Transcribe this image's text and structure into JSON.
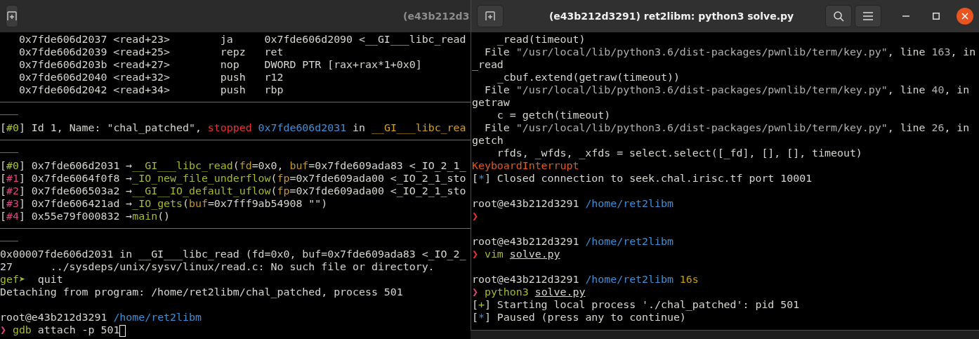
{
  "windows": [
    {
      "title": "(e43b212d3",
      "active": false,
      "lines": [
        {
          "kind": "text",
          "segments": [
            {
              "kind": "plain",
              "text": "   0x7fde606d2037 <read+23>        ja     0x7fde606d2090 <__GI___libc_read"
            }
          ]
        },
        {
          "kind": "text",
          "segments": [
            {
              "kind": "plain",
              "text": "   0x7fde606d2039 <read+25>        repz   ret"
            }
          ]
        },
        {
          "kind": "text",
          "segments": [
            {
              "kind": "plain",
              "text": "   0x7fde606d203b <read+27>        nop    DWORD PTR [rax+rax*1+0x0]"
            }
          ]
        },
        {
          "kind": "text",
          "segments": [
            {
              "kind": "plain",
              "text": "   0x7fde606d2040 <read+32>        push   r12"
            }
          ]
        },
        {
          "kind": "text",
          "segments": [
            {
              "kind": "plain",
              "text": "   0x7fde606d2042 <read+34>        push   rbp"
            }
          ]
        },
        {
          "kind": "rule"
        },
        {
          "kind": "dash"
        },
        {
          "kind": "text",
          "segments": [
            {
              "kind": "plain",
              "text": "["
            },
            {
              "kind": "green",
              "text": "#0"
            },
            {
              "kind": "plain",
              "text": "] Id 1, Name: \"chal_patched\", "
            },
            {
              "kind": "red",
              "text": "stopped "
            },
            {
              "kind": "blue",
              "text": "0x7fde606d2031"
            },
            {
              "kind": "plain",
              "text": " in "
            },
            {
              "kind": "yellow",
              "text": "__GI___libc_rea"
            }
          ]
        },
        {
          "kind": "rule"
        },
        {
          "kind": "dash"
        },
        {
          "kind": "text",
          "segments": [
            {
              "kind": "plain",
              "text": "["
            },
            {
              "kind": "green",
              "text": "#0"
            },
            {
              "kind": "plain",
              "text": "] 0x7fde606d2031 →"
            },
            {
              "kind": "olive",
              "text": "__GI___libc_read"
            },
            {
              "kind": "plain",
              "text": "("
            },
            {
              "kind": "param",
              "text": "fd"
            },
            {
              "kind": "plain",
              "text": "=0x0, "
            },
            {
              "kind": "param",
              "text": "buf"
            },
            {
              "kind": "plain",
              "text": "=0x7fde609ada83 <_IO_2_1_"
            }
          ]
        },
        {
          "kind": "text",
          "segments": [
            {
              "kind": "plain",
              "text": "["
            },
            {
              "kind": "pink",
              "text": "#1"
            },
            {
              "kind": "plain",
              "text": "] 0x7fde6064f0f8 →"
            },
            {
              "kind": "olive",
              "text": "_IO_new_file_underflow"
            },
            {
              "kind": "plain",
              "text": "("
            },
            {
              "kind": "param",
              "text": "fp"
            },
            {
              "kind": "plain",
              "text": "=0x7fde609ada00 <_IO_2_1_sto"
            }
          ]
        },
        {
          "kind": "text",
          "segments": [
            {
              "kind": "plain",
              "text": "["
            },
            {
              "kind": "pink",
              "text": "#2"
            },
            {
              "kind": "plain",
              "text": "] 0x7fde606503a2 →"
            },
            {
              "kind": "olive",
              "text": "__GI__IO_default_uflow"
            },
            {
              "kind": "plain",
              "text": "("
            },
            {
              "kind": "param",
              "text": "fp"
            },
            {
              "kind": "plain",
              "text": "=0x7fde609ada00 <_IO_2_1_sto"
            }
          ]
        },
        {
          "kind": "text",
          "segments": [
            {
              "kind": "plain",
              "text": "["
            },
            {
              "kind": "pink",
              "text": "#3"
            },
            {
              "kind": "plain",
              "text": "] 0x7fde606421ad →"
            },
            {
              "kind": "olive",
              "text": "_IO_gets"
            },
            {
              "kind": "plain",
              "text": "("
            },
            {
              "kind": "param",
              "text": "buf"
            },
            {
              "kind": "plain",
              "text": "=0x7fff9ab54908 \"\")"
            }
          ]
        },
        {
          "kind": "text",
          "segments": [
            {
              "kind": "plain",
              "text": "["
            },
            {
              "kind": "pink",
              "text": "#4"
            },
            {
              "kind": "plain",
              "text": "] 0x55e79f000832 →"
            },
            {
              "kind": "olive",
              "text": "main"
            },
            {
              "kind": "plain",
              "text": "()"
            }
          ]
        },
        {
          "kind": "rule"
        },
        {
          "kind": "dash"
        },
        {
          "kind": "text",
          "segments": [
            {
              "kind": "plain",
              "text": "0x00007fde606d2031 in __GI___libc_read (fd=0x0, buf=0x7fde609ada83 <_IO_2_"
            }
          ]
        },
        {
          "kind": "text",
          "segments": [
            {
              "kind": "plain",
              "text": "27      ../sysdeps/unix/sysv/linux/read.c: No such file or directory."
            }
          ]
        },
        {
          "kind": "text",
          "segments": [
            {
              "kind": "olive",
              "text": "gef➤"
            },
            {
              "kind": "plain",
              "text": "  quit"
            }
          ]
        },
        {
          "kind": "text",
          "segments": [
            {
              "kind": "plain",
              "text": "Detaching from program: /home/ret2libm/chal_patched, process 501"
            }
          ]
        },
        {
          "kind": "blank"
        },
        {
          "kind": "text",
          "segments": [
            {
              "kind": "plain",
              "text": "root@e43b212d3291 "
            },
            {
              "kind": "blue",
              "text": "/home/ret2libm"
            }
          ]
        },
        {
          "kind": "text",
          "segments": [
            {
              "kind": "pink",
              "text": "❯ "
            },
            {
              "kind": "olive",
              "text": "gdb"
            },
            {
              "kind": "plain",
              "text": " attach -p 501"
            },
            {
              "kind": "cursor"
            }
          ]
        }
      ]
    },
    {
      "title": "(e43b212d3291) ret2libm: python3 solve.py",
      "active": true,
      "lines": [
        {
          "kind": "text",
          "segments": [
            {
              "kind": "plain",
              "text": "    _read(timeout)"
            }
          ]
        },
        {
          "kind": "text",
          "segments": [
            {
              "kind": "plain",
              "text": "  File "
            },
            {
              "kind": "string",
              "text": "\"/usr/local/lib/python3.6/dist-packages/pwnlib/term/key.py\""
            },
            {
              "kind": "plain",
              "text": ", line "
            },
            {
              "kind": "string",
              "text": "163"
            },
            {
              "kind": "plain",
              "text": ", in"
            }
          ]
        },
        {
          "kind": "text",
          "segments": [
            {
              "kind": "plain",
              "text": "_read"
            }
          ]
        },
        {
          "kind": "text",
          "segments": [
            {
              "kind": "plain",
              "text": "    _cbuf.extend(getraw(timeout))"
            }
          ]
        },
        {
          "kind": "text",
          "segments": [
            {
              "kind": "plain",
              "text": "  File "
            },
            {
              "kind": "string",
              "text": "\"/usr/local/lib/python3.6/dist-packages/pwnlib/term/key.py\""
            },
            {
              "kind": "plain",
              "text": ", line "
            },
            {
              "kind": "string",
              "text": "40"
            },
            {
              "kind": "plain",
              "text": ", in"
            }
          ]
        },
        {
          "kind": "text",
          "segments": [
            {
              "kind": "plain",
              "text": "getraw"
            }
          ]
        },
        {
          "kind": "text",
          "segments": [
            {
              "kind": "plain",
              "text": "    c = getch(timeout)"
            }
          ]
        },
        {
          "kind": "text",
          "segments": [
            {
              "kind": "plain",
              "text": "  File "
            },
            {
              "kind": "string",
              "text": "\"/usr/local/lib/python3.6/dist-packages/pwnlib/term/key.py\""
            },
            {
              "kind": "plain",
              "text": ", line "
            },
            {
              "kind": "string",
              "text": "26"
            },
            {
              "kind": "plain",
              "text": ", in"
            }
          ]
        },
        {
          "kind": "text",
          "segments": [
            {
              "kind": "plain",
              "text": "getch"
            }
          ]
        },
        {
          "kind": "text",
          "segments": [
            {
              "kind": "plain",
              "text": "    rfds, _wfds, _xfds = select.select([_fd], [], [], timeout)"
            }
          ]
        },
        {
          "kind": "text",
          "segments": [
            {
              "kind": "error",
              "text": "KeyboardInterrupt"
            }
          ]
        },
        {
          "kind": "text",
          "segments": [
            {
              "kind": "plain",
              "text": "["
            },
            {
              "kind": "blue",
              "text": "*"
            },
            {
              "kind": "plain",
              "text": "] Closed connection to seek.chal.irisc.tf port 10001"
            }
          ]
        },
        {
          "kind": "blank"
        },
        {
          "kind": "text",
          "segments": [
            {
              "kind": "plain",
              "text": "root@e43b212d3291 "
            },
            {
              "kind": "blue",
              "text": "/home/ret2libm"
            }
          ]
        },
        {
          "kind": "text",
          "segments": [
            {
              "kind": "red",
              "text": "❯"
            }
          ]
        },
        {
          "kind": "blank"
        },
        {
          "kind": "text",
          "segments": [
            {
              "kind": "plain",
              "text": "root@e43b212d3291 "
            },
            {
              "kind": "blue",
              "text": "/home/ret2libm"
            }
          ]
        },
        {
          "kind": "text",
          "segments": [
            {
              "kind": "red",
              "text": "❯ "
            },
            {
              "kind": "olive",
              "text": "vim "
            },
            {
              "kind": "underline",
              "text": "solve.py"
            }
          ]
        },
        {
          "kind": "blank"
        },
        {
          "kind": "text",
          "segments": [
            {
              "kind": "plain",
              "text": "root@e43b212d3291 "
            },
            {
              "kind": "blue",
              "text": "/home/ret2libm "
            },
            {
              "kind": "orange",
              "text": "16s"
            }
          ]
        },
        {
          "kind": "text",
          "segments": [
            {
              "kind": "pink",
              "text": "❯ "
            },
            {
              "kind": "olive",
              "text": "python3 "
            },
            {
              "kind": "underline",
              "text": "solve.py"
            }
          ]
        },
        {
          "kind": "text",
          "segments": [
            {
              "kind": "plain",
              "text": "["
            },
            {
              "kind": "green",
              "text": "+"
            },
            {
              "kind": "plain",
              "text": "] Starting local process './chal_patched': pid 501"
            }
          ]
        },
        {
          "kind": "text",
          "segments": [
            {
              "kind": "plain",
              "text": "["
            },
            {
              "kind": "blue",
              "text": "*"
            },
            {
              "kind": "plain",
              "text": "] Paused (press any to continue)"
            }
          ]
        }
      ]
    }
  ]
}
